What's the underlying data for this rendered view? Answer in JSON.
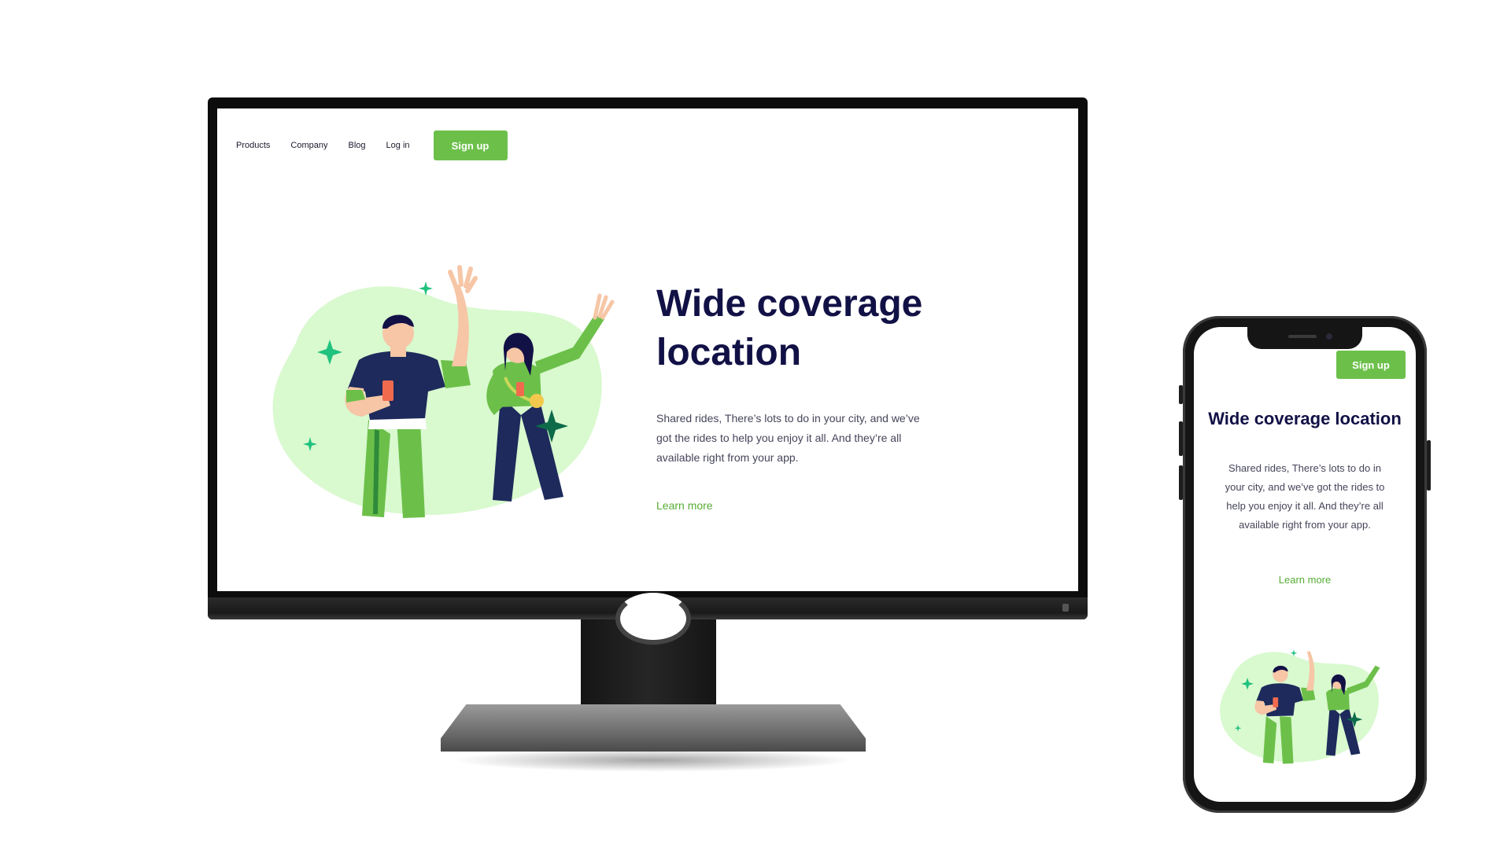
{
  "desktop": {
    "nav": {
      "links": [
        "Products",
        "Company",
        "Blog",
        "Log in"
      ],
      "signup_label": "Sign up"
    },
    "hero": {
      "title": "Wide coverage location",
      "description": "Shared rides, There’s lots to do in your city, and we’ve got the rides to help you enjoy it all. And they’re all available right from your app.",
      "link_label": "Learn more"
    }
  },
  "mobile": {
    "signup_label": "Sign up",
    "hero": {
      "title": "Wide coverage location",
      "description": "Shared rides, There’s lots to do in your city, and we’ve got the rides to help you enjoy it all. And they’re all available right from your app.",
      "link_label": "Learn more"
    }
  },
  "colors": {
    "accent_green": "#6cc04a",
    "link_green": "#57ad35",
    "title_navy": "#121146",
    "body_text": "#45455a",
    "blob": "#d9f9cf",
    "sparkle": "#1fc27e"
  },
  "icons": [
    "sparkle-icon"
  ]
}
